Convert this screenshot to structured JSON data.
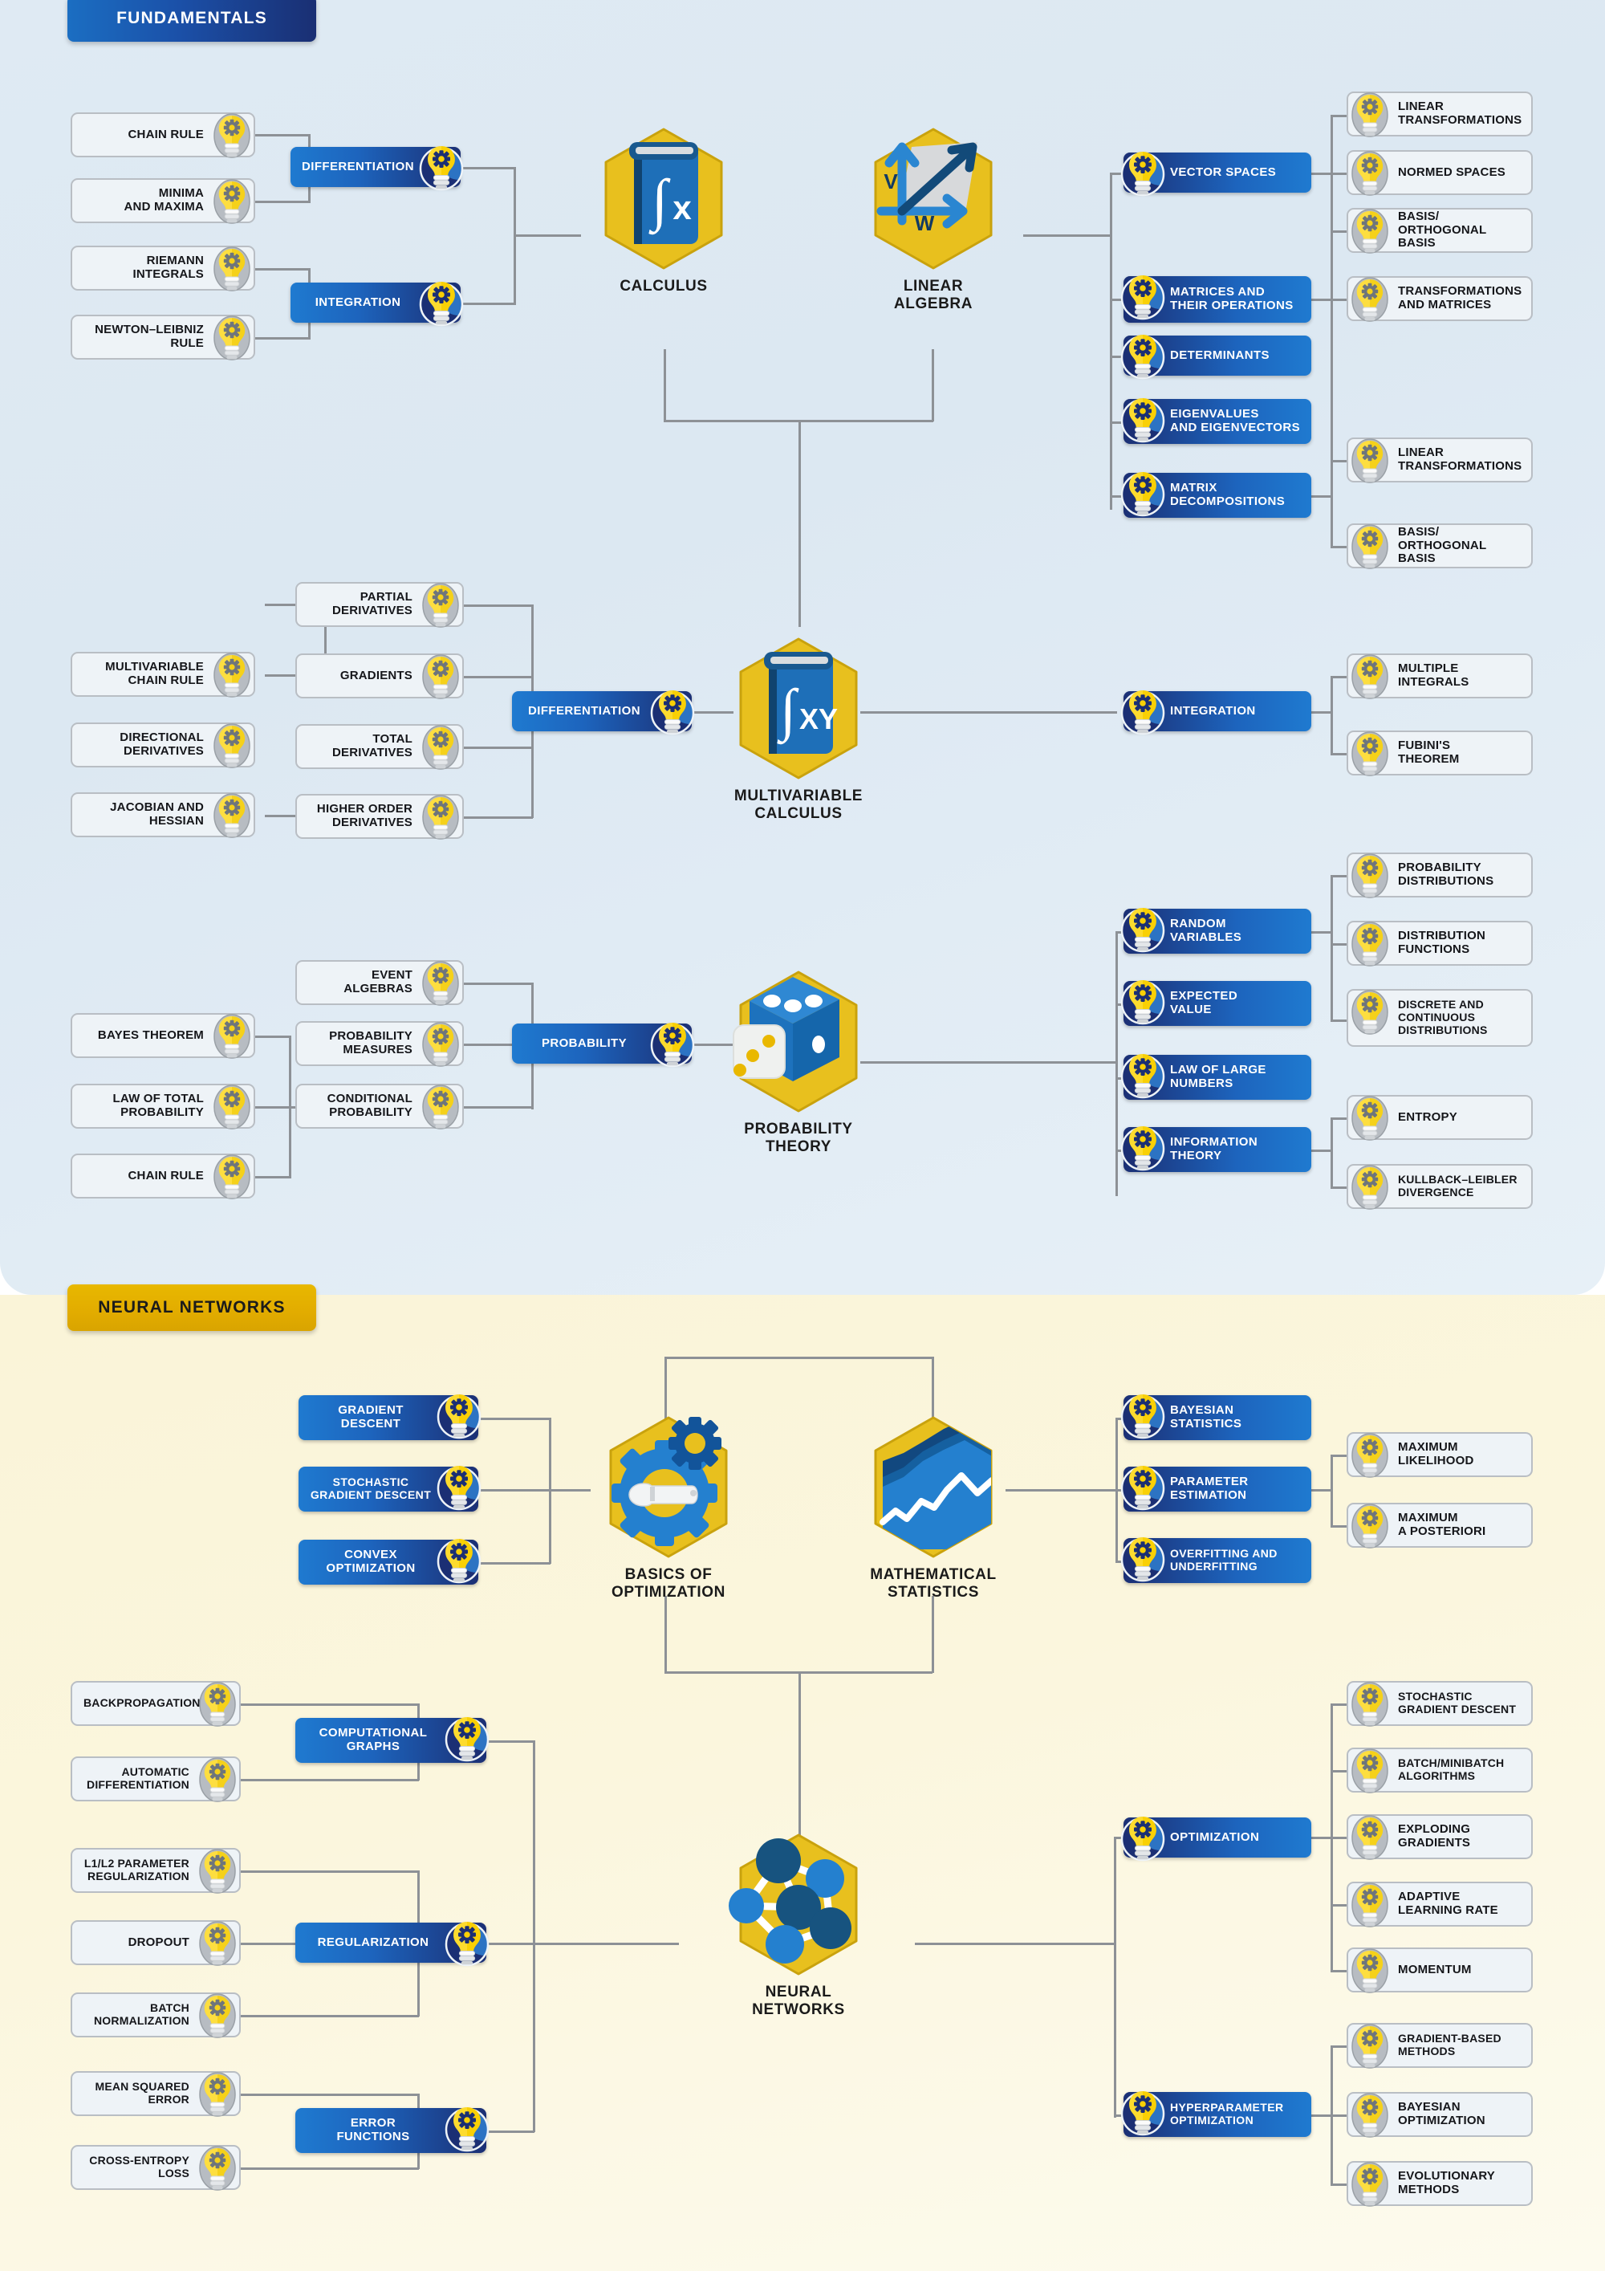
{
  "sections": {
    "fundamentals": {
      "banner": "FUNDAMENTALS"
    },
    "neural": {
      "banner": "NEURAL NETWORKS"
    }
  },
  "colors": {
    "accent_blue": "#1b6ec2",
    "deep_navy": "#1a2f73",
    "gold": "#e8b800",
    "leaf_border": "#b9bec4",
    "connector": "#8d9196",
    "panel_blue_bg": "#dce8f2",
    "panel_yellow_bg": "#faf4d8"
  },
  "hubs": {
    "calculus": {
      "label": "CALCULUS",
      "icon": "book-integral-fx-icon"
    },
    "linear_algebra": {
      "label": "LINEAR\nALGEBRA",
      "label_l1": "LINEAR",
      "label_l2": "ALGEBRA",
      "icon": "vectors-v-w-icon",
      "glyph_v": "V",
      "glyph_w": "W"
    },
    "multivariable_calculus": {
      "label_l1": "MULTIVARIABLE",
      "label_l2": "CALCULUS",
      "icon": "book-integral-fxy-icon"
    },
    "probability_theory": {
      "label_l1": "PROBABILITY",
      "label_l2": "THEORY",
      "icon": "dice-icon"
    },
    "basics_of_optimization": {
      "label_l1": "BASICS OF",
      "label_l2": "OPTIMIZATION",
      "icon": "gear-wrench-icon"
    },
    "mathematical_statistics": {
      "label_l1": "MATHEMATICAL",
      "label_l2": "STATISTICS",
      "icon": "area-chart-icon"
    },
    "neural_networks": {
      "label_l1": "NEURAL",
      "label_l2": "NETWORKS",
      "icon": "neural-graph-icon"
    }
  },
  "calculus": {
    "branches": [
      {
        "label": "DIFFERENTIATION",
        "leaves": [
          "CHAIN RULE",
          "MINIMA\nAND MAXIMA"
        ],
        "leaf_1_l1": "CHAIN RULE",
        "leaf_2_l1": "MINIMA",
        "leaf_2_l2": "AND MAXIMA"
      },
      {
        "label": "INTEGRATION",
        "leaf_1_l1": "RIEMANN",
        "leaf_1_l2": "INTEGRALS",
        "leaf_2_l1": "NEWTON–LEIBNIZ",
        "leaf_2_l2": "RULE"
      }
    ]
  },
  "linear_algebra": {
    "branches": [
      {
        "label": "VECTOR SPACES",
        "leaves": [
          {
            "l1": "LINEAR",
            "l2": "TRANSFORMATIONS"
          },
          {
            "l1": "NORMED SPACES",
            "l2": ""
          },
          {
            "l1": "BASIS/",
            "l2": "ORTHOGONAL BASIS"
          }
        ]
      },
      {
        "label_l1": "MATRICES AND",
        "label_l2": "THEIR OPERATIONS",
        "leaves": [
          {
            "l1": "TRANSFORMATIONS",
            "l2": "AND MATRICES"
          }
        ]
      },
      {
        "label": "DETERMINANTS",
        "leaves": []
      },
      {
        "label_l1": "EIGENVALUES",
        "label_l2": "AND EIGENVECTORS",
        "leaves": []
      },
      {
        "label_l1": "MATRIX",
        "label_l2": "DECOMPOSITIONS",
        "leaves": [
          {
            "l1": "LINEAR",
            "l2": "TRANSFORMATIONS"
          },
          {
            "l1": "BASIS/",
            "l2": "ORTHOGONAL BASIS"
          }
        ]
      }
    ]
  },
  "multivariable_calculus": {
    "left_branch": {
      "label": "DIFFERENTIATION"
    },
    "mid_leaves": [
      {
        "l1": "PARTIAL",
        "l2": "DERIVATIVES"
      },
      {
        "l1": "GRADIENTS",
        "l2": ""
      },
      {
        "l1": "TOTAL",
        "l2": "DERIVATIVES"
      },
      {
        "l1": "HIGHER ORDER",
        "l2": "DERIVATIVES"
      }
    ],
    "outer_leaves": [
      {
        "l1": "MULTIVARIABLE",
        "l2": "CHAIN RULE"
      },
      {
        "l1": "DIRECTIONAL",
        "l2": "DERIVATIVES"
      },
      {
        "l1": "JACOBIAN AND",
        "l2": "HESSIAN"
      }
    ],
    "right_branch": {
      "label": "INTEGRATION"
    },
    "right_leaves": [
      {
        "l1": "MULTIPLE",
        "l2": "INTEGRALS"
      },
      {
        "l1": "FUBINI'S",
        "l2": "THEOREM"
      }
    ]
  },
  "probability_theory": {
    "left_branch": {
      "label": "PROBABILITY"
    },
    "mid_leaves": [
      {
        "l1": "EVENT ALGEBRAS",
        "l2": ""
      },
      {
        "l1": "PROBABILITY",
        "l2": "MEASURES"
      },
      {
        "l1": "CONDITIONAL",
        "l2": "PROBABILITY"
      }
    ],
    "outer_leaves": [
      {
        "l1": "BAYES THEOREM",
        "l2": ""
      },
      {
        "l1": "LAW OF TOTAL",
        "l2": "PROBABILITY"
      },
      {
        "l1": "CHAIN RULE",
        "l2": ""
      }
    ],
    "right_branches": [
      {
        "label_l1": "RANDOM",
        "label_l2": "VARIABLES",
        "leaves": [
          {
            "l1": "PROBABILITY",
            "l2": "DISTRIBUTIONS",
            "l3": ""
          },
          {
            "l1": "DISTRIBUTION",
            "l2": "FUNCTIONS",
            "l3": ""
          },
          {
            "l1": "DISCRETE AND",
            "l2": "CONTINUOUS",
            "l3": "DISTRIBUTIONS"
          }
        ]
      },
      {
        "label_l1": "EXPECTED",
        "label_l2": "VALUE",
        "leaves": []
      },
      {
        "label_l1": "LAW OF LARGE",
        "label_l2": "NUMBERS",
        "leaves": []
      },
      {
        "label_l1": "INFORMATION",
        "label_l2": "THEORY",
        "leaves": [
          {
            "l1": "ENTROPY",
            "l2": ""
          },
          {
            "l1": "KULLBACK–LEIBLER",
            "l2": "DIVERGENCE"
          }
        ]
      }
    ]
  },
  "basics_of_optimization": {
    "pills": [
      {
        "l1": "GRADIENT",
        "l2": "DESCENT"
      },
      {
        "l1": "STOCHASTIC",
        "l2": "GRADIENT DESCENT"
      },
      {
        "l1": "CONVEX",
        "l2": "OPTIMIZATION"
      }
    ]
  },
  "mathematical_statistics": {
    "pills": [
      {
        "l1": "BAYESIAN",
        "l2": "STATISTICS",
        "leaves": []
      },
      {
        "l1": "PARAMETER",
        "l2": "ESTIMATION",
        "leaves": [
          {
            "l1": "MAXIMUM",
            "l2": "LIKELIHOOD"
          },
          {
            "l1": "MAXIMUM",
            "l2": "A POSTERIORI"
          }
        ]
      },
      {
        "l1": "OVERFITTING AND",
        "l2": "UNDERFITTING",
        "leaves": []
      }
    ]
  },
  "neural_networks": {
    "left_branches": [
      {
        "label_l1": "COMPUTATIONAL",
        "label_l2": "GRAPHS",
        "leaves": [
          {
            "l1": "BACKPROPAGATION",
            "l2": ""
          },
          {
            "l1": "AUTOMATIC",
            "l2": "DIFFERENTIATION"
          }
        ]
      },
      {
        "label_l1": "REGULARIZATION",
        "label_l2": "",
        "leaves": [
          {
            "l1": "L1/L2 PARAMETER",
            "l2": "REGULARIZATION"
          },
          {
            "l1": "DROPOUT",
            "l2": ""
          },
          {
            "l1": "BATCH",
            "l2": "NORMALIZATION"
          }
        ]
      },
      {
        "label_l1": "ERROR",
        "label_l2": "FUNCTIONS",
        "leaves": [
          {
            "l1": "MEAN SQUARED",
            "l2": "ERROR"
          },
          {
            "l1": "CROSS-ENTROPY",
            "l2": "LOSS"
          }
        ]
      }
    ],
    "right_branches": [
      {
        "label_l1": "OPTIMIZATION",
        "label_l2": "",
        "leaves": [
          {
            "l1": "STOCHASTIC",
            "l2": "GRADIENT DESCENT"
          },
          {
            "l1": "BATCH/MINIBATCH",
            "l2": "ALGORITHMS"
          },
          {
            "l1": "EXPLODING",
            "l2": "GRADIENTS"
          },
          {
            "l1": "ADAPTIVE",
            "l2": "LEARNING RATE"
          },
          {
            "l1": "MOMENTUM",
            "l2": ""
          }
        ]
      },
      {
        "label_l1": "HYPERPARAMETER",
        "label_l2": "OPTIMIZATION",
        "leaves": [
          {
            "l1": "GRADIENT-BASED",
            "l2": "METHODS"
          },
          {
            "l1": "BAYESIAN",
            "l2": "OPTIMIZATION"
          },
          {
            "l1": "EVOLUTIONARY",
            "l2": "METHODS"
          }
        ]
      }
    ]
  }
}
